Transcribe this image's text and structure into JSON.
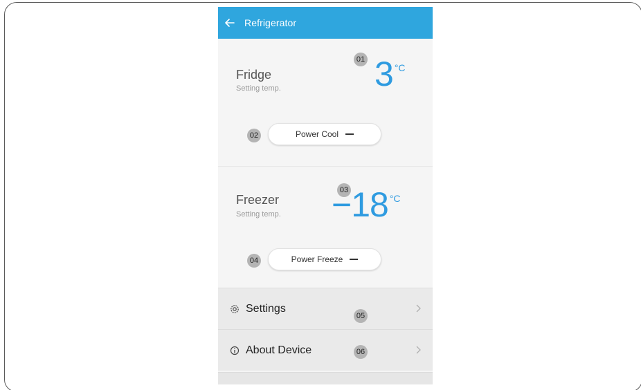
{
  "appbar": {
    "title": "Refrigerator",
    "back_icon": "arrow-left-icon"
  },
  "fridge": {
    "name": "Fridge",
    "subtitle": "Setting temp.",
    "temperature": "3",
    "unit": "°C",
    "marker": "01",
    "button": {
      "label": "Power Cool",
      "marker": "02"
    }
  },
  "freezer": {
    "name": "Freezer",
    "subtitle": "Setting temp.",
    "temperature": "−18",
    "unit": "°C",
    "marker": "03",
    "button": {
      "label": "Power Freeze",
      "marker": "04"
    }
  },
  "menu": {
    "settings": {
      "label": "Settings",
      "icon": "gear-icon",
      "marker": "05"
    },
    "about": {
      "label": "About Device",
      "icon": "info-icon",
      "marker": "06"
    }
  },
  "colors": {
    "accent": "#2fa6de",
    "temp_text": "#2f9be0",
    "marker_bg": "#b4b4b4"
  }
}
